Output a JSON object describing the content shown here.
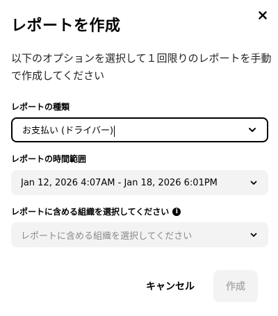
{
  "dialog": {
    "title": "レポートを作成",
    "close_icon": "close-icon",
    "description": "以下のオプションを選択して１回限りのレポートを手動で作成してください"
  },
  "report_type": {
    "label": "レポートの種類",
    "value": "お支払い (ドライバー)"
  },
  "time_range": {
    "label": "レポートの時間範囲",
    "value": "Jan 12, 2026 4:07AM - Jan 18, 2026 6:01PM"
  },
  "organizations": {
    "label": "レポートに含める組織を選択してください",
    "info_icon": "info-icon",
    "placeholder": "レポートに含める組織を選択してください"
  },
  "actions": {
    "cancel_label": "キャンセル",
    "create_label": "作成"
  },
  "colors": {
    "field_background": "#f3f3f3",
    "disabled_text": "#afafaf",
    "placeholder_text": "#8a8a8a",
    "primary_text": "#000000"
  }
}
